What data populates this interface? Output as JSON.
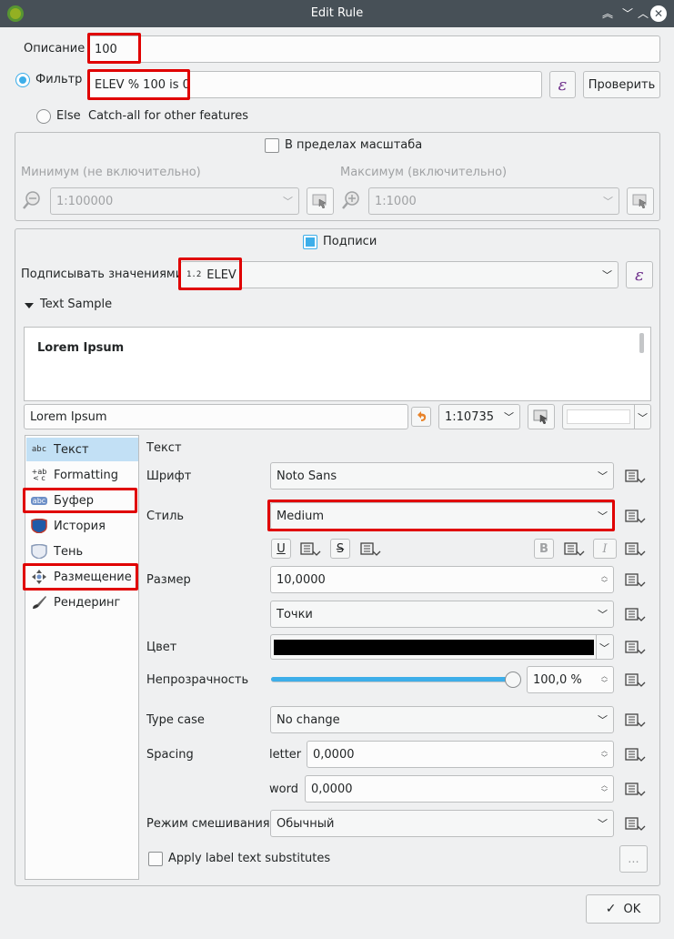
{
  "window": {
    "title": "Edit Rule"
  },
  "description": {
    "label": "Описание",
    "value": "100"
  },
  "filter": {
    "label": "Фильтр",
    "value": "ELEV % 100 is 0",
    "test_button": "Проверить"
  },
  "else": {
    "label": "Else",
    "text": "Catch-all for other features"
  },
  "scale": {
    "checkbox_label": "В пределах масштаба",
    "min_label": "Минимум (не включительно)",
    "max_label": "Максимум (включительно)",
    "min_value": "1:100000",
    "max_value": "1:1000"
  },
  "labels": {
    "checkbox_label": "Подписи",
    "label_with": "Подписывать значениями",
    "field_type": "1.2",
    "field_value": "ELEV",
    "text_sample_header": "Text Sample",
    "sample_text": "Lorem Ipsum",
    "sample_input": "Lorem Ipsum",
    "preview_scale": "1:10735"
  },
  "sidebar": {
    "items": [
      {
        "label": "Текст",
        "icon": "abc-text-icon"
      },
      {
        "label": "Formatting",
        "icon": "formatting-icon"
      },
      {
        "label": "Буфер",
        "icon": "buffer-icon"
      },
      {
        "label": "История",
        "icon": "history-shield-icon"
      },
      {
        "label": "Тень",
        "icon": "shadow-icon"
      },
      {
        "label": "Размещение",
        "icon": "placement-icon"
      },
      {
        "label": "Рендеринг",
        "icon": "rendering-brush-icon"
      }
    ]
  },
  "text_panel": {
    "header": "Текст",
    "font_label": "Шрифт",
    "font_value": "Noto Sans",
    "style_label": "Стиль",
    "style_value": "Medium",
    "underline": "U",
    "strike": "S",
    "bold": "B",
    "italic": "I",
    "size_label": "Размер",
    "size_value": "10,0000",
    "unit_value": "Точки",
    "color_label": "Цвет",
    "color_value": "#000000",
    "opacity_label": "Непрозрачность",
    "opacity_value": "100,0 %",
    "opacity_level": 1.0,
    "typecase_label": "Type case",
    "typecase_value": "No change",
    "spacing_label": "Spacing",
    "letter_label": "letter",
    "letter_value": "0,0000",
    "word_label": "word",
    "word_value": "0,0000",
    "blend_label": "Режим смешивания",
    "blend_value": "Обычный",
    "substitutes_label": "Apply label text substitutes",
    "substitutes_button": "..."
  },
  "footer": {
    "ok": "OK"
  },
  "colors": {
    "accent": "#3daee9",
    "highlight": "#e00000",
    "titlebar": "#475057"
  }
}
